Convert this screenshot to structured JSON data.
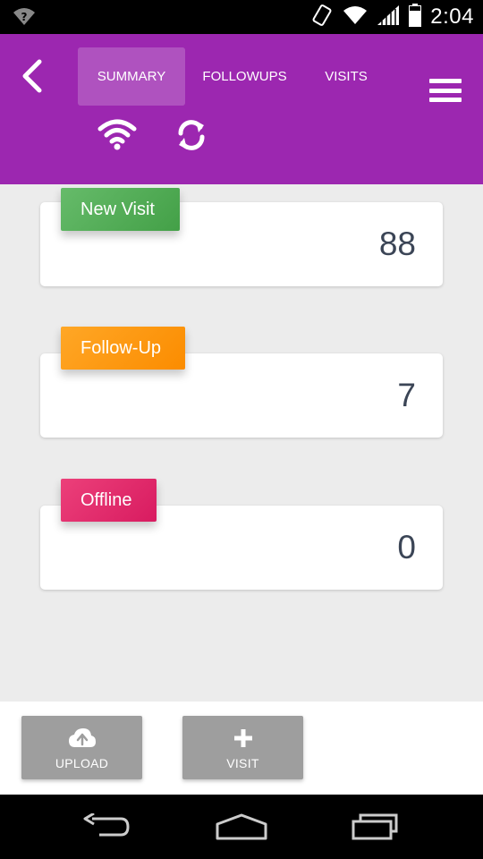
{
  "status_bar": {
    "time": "2:04",
    "icons": [
      "wifi-unknown-icon",
      "rotation-icon",
      "wifi-icon",
      "cell-signal-icon",
      "battery-icon"
    ]
  },
  "header": {
    "tabs": [
      {
        "label": "SUMMARY",
        "active": true
      },
      {
        "label": "FOLLOWUPS",
        "active": false
      },
      {
        "label": "VISITS",
        "active": false
      }
    ],
    "icons": [
      "back-arrow-icon",
      "menu-icon",
      "wifi-icon",
      "sync-icon"
    ],
    "background": "#9c27b0"
  },
  "cards": [
    {
      "label": "New Visit",
      "count": "88",
      "color": "#4caf50"
    },
    {
      "label": "Follow-Up",
      "count": "7",
      "color": "#ff9800"
    },
    {
      "label": "Offline",
      "count": "0",
      "color": "#e91e63"
    }
  ],
  "actions": {
    "upload_label": "UPLOAD",
    "visit_label": "VISIT",
    "upload_icon": "cloud-upload-icon",
    "visit_icon": "plus-icon"
  },
  "nav": {
    "icons": [
      "nav-back-icon",
      "nav-home-icon",
      "nav-recents-icon"
    ]
  }
}
